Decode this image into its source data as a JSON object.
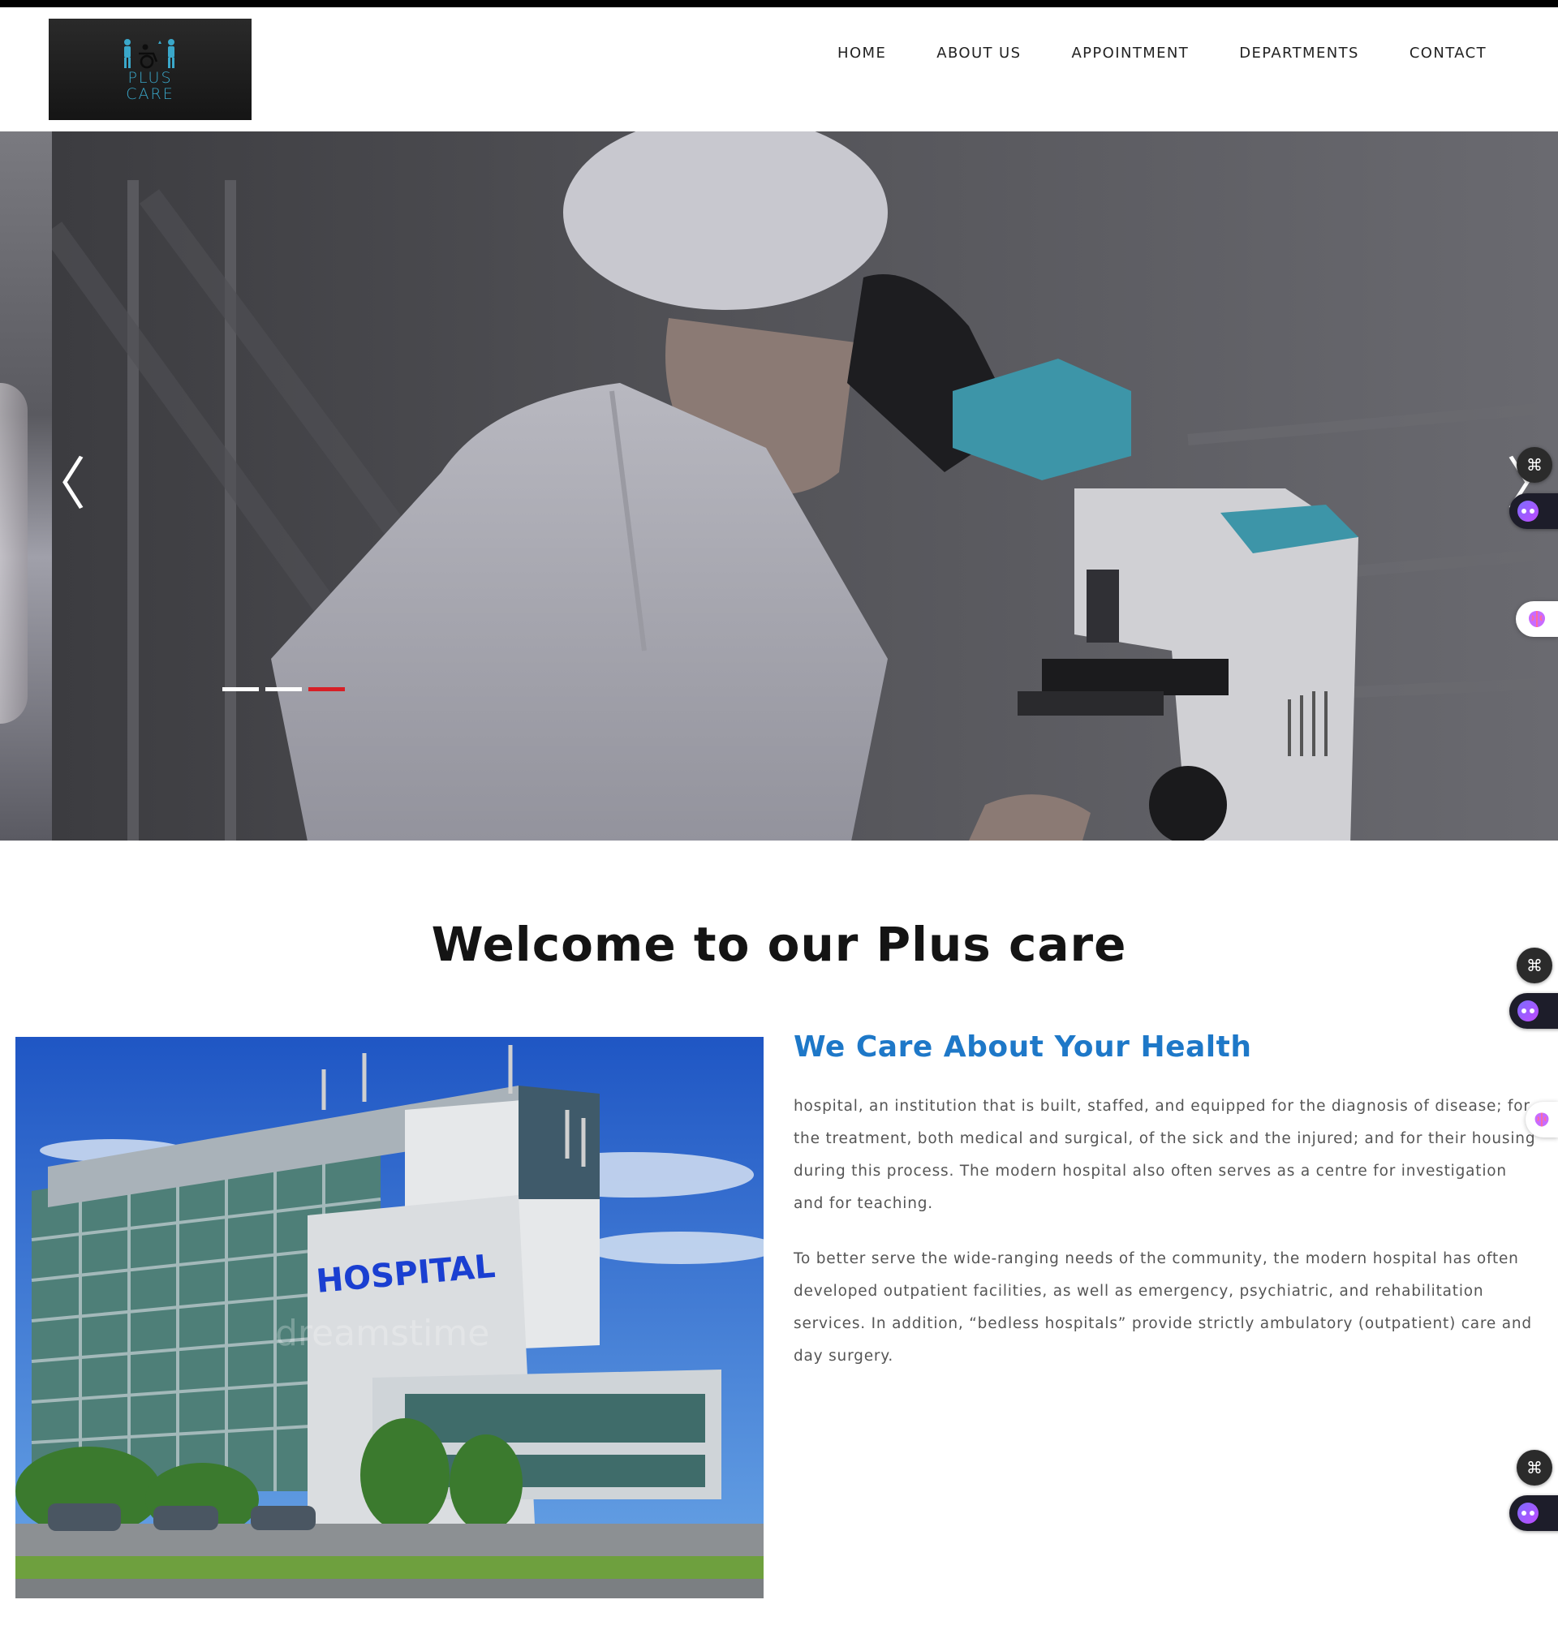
{
  "brand": {
    "logo_line1": "PLUS",
    "logo_line2": "CARE"
  },
  "nav": {
    "items": [
      "HOME",
      "ABOUT US",
      "APPOINTMENT",
      "DEPARTMENTS",
      "CONTACT"
    ]
  },
  "hero": {
    "prev_arrow": "〈",
    "next_arrow": "〉",
    "slide_count": 3,
    "active_slide": 3
  },
  "floating_widgets": {
    "grid_icon": "⌘"
  },
  "welcome": {
    "title": "Welcome to our Plus care"
  },
  "about": {
    "heading": "We Care About Your Health",
    "paragraph1": "hospital, an institution that is built, staffed, and equipped for the diagnosis of disease; for the treatment, both medical and surgical, of the sick and the injured; and for their housing during this process. The modern hospital also often serves as a centre for investigation and for teaching.",
    "paragraph2": "To better serve the wide-ranging needs of the community, the modern hospital has often developed outpatient facilities, as well as emergency, psychiatric, and rehabilitation services. In addition, “bedless hospitals” provide strictly ambulatory (outpatient) care and day surgery.",
    "image_sign": "HOSPITAL",
    "image_watermark": "dreamstime"
  },
  "colors": {
    "accent": "#1e78c8",
    "active_dot": "#d71f26",
    "logo_text": "#3aa7c9"
  }
}
